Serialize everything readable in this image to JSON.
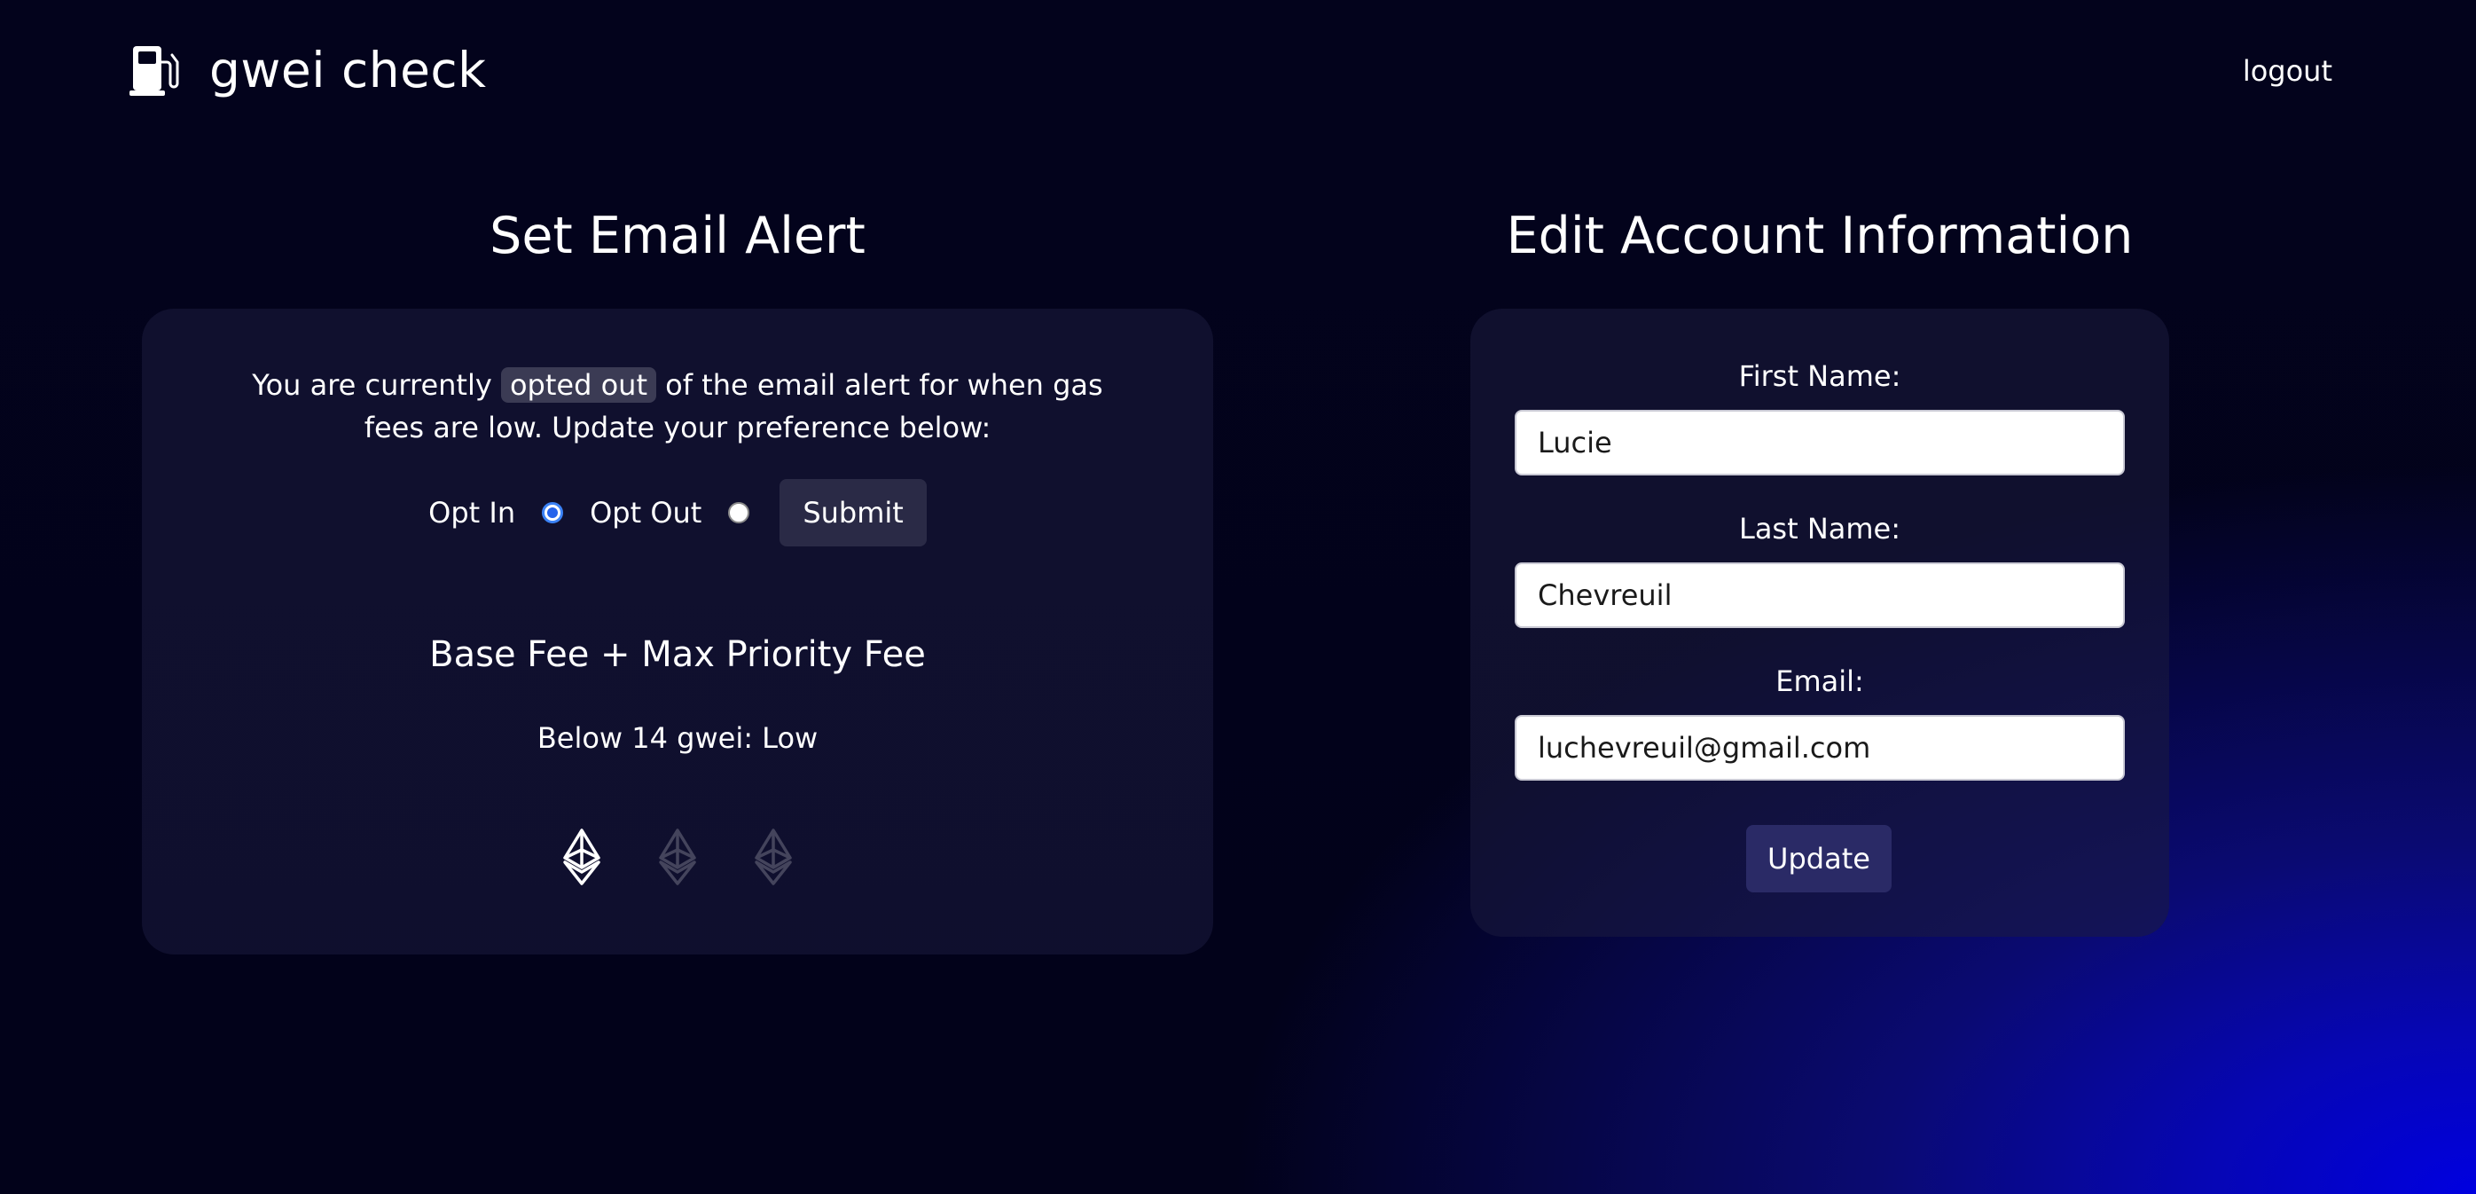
{
  "header": {
    "brand": "gwei check",
    "brand_icon": "gas-pump-icon",
    "logout_label": "logout"
  },
  "email_alert": {
    "title": "Set Email Alert",
    "status_prefix": "You are currently",
    "status_value": "opted out",
    "status_suffix": "of the email alert for when gas fees are low. Update your preference below:",
    "opt_in_label": "Opt In",
    "opt_in_checked": true,
    "opt_out_label": "Opt Out",
    "opt_out_checked": false,
    "submit_label": "Submit",
    "fee_heading": "Base Fee + Max Priority Fee",
    "fee_level_text": "Below 14 gwei: Low",
    "level_icons": [
      {
        "icon": "ethereum-icon",
        "active": true
      },
      {
        "icon": "ethereum-icon",
        "active": false
      },
      {
        "icon": "ethereum-icon",
        "active": false
      }
    ],
    "level_active_count": 1,
    "level_total": 3
  },
  "account": {
    "title": "Edit Account Information",
    "first_name_label": "First Name:",
    "first_name_value": "Lucie",
    "last_name_label": "Last Name:",
    "last_name_value": "Chevreuil",
    "email_label": "Email:",
    "email_value": "luchevreuil@gmail.com",
    "update_label": "Update"
  },
  "colors": {
    "background": "#02021a",
    "glow": "#0000e0",
    "card": "#1c1c3e",
    "radio_selected": "#2563eb",
    "button": "#2a2a46",
    "update_button": "#2a2a66"
  }
}
